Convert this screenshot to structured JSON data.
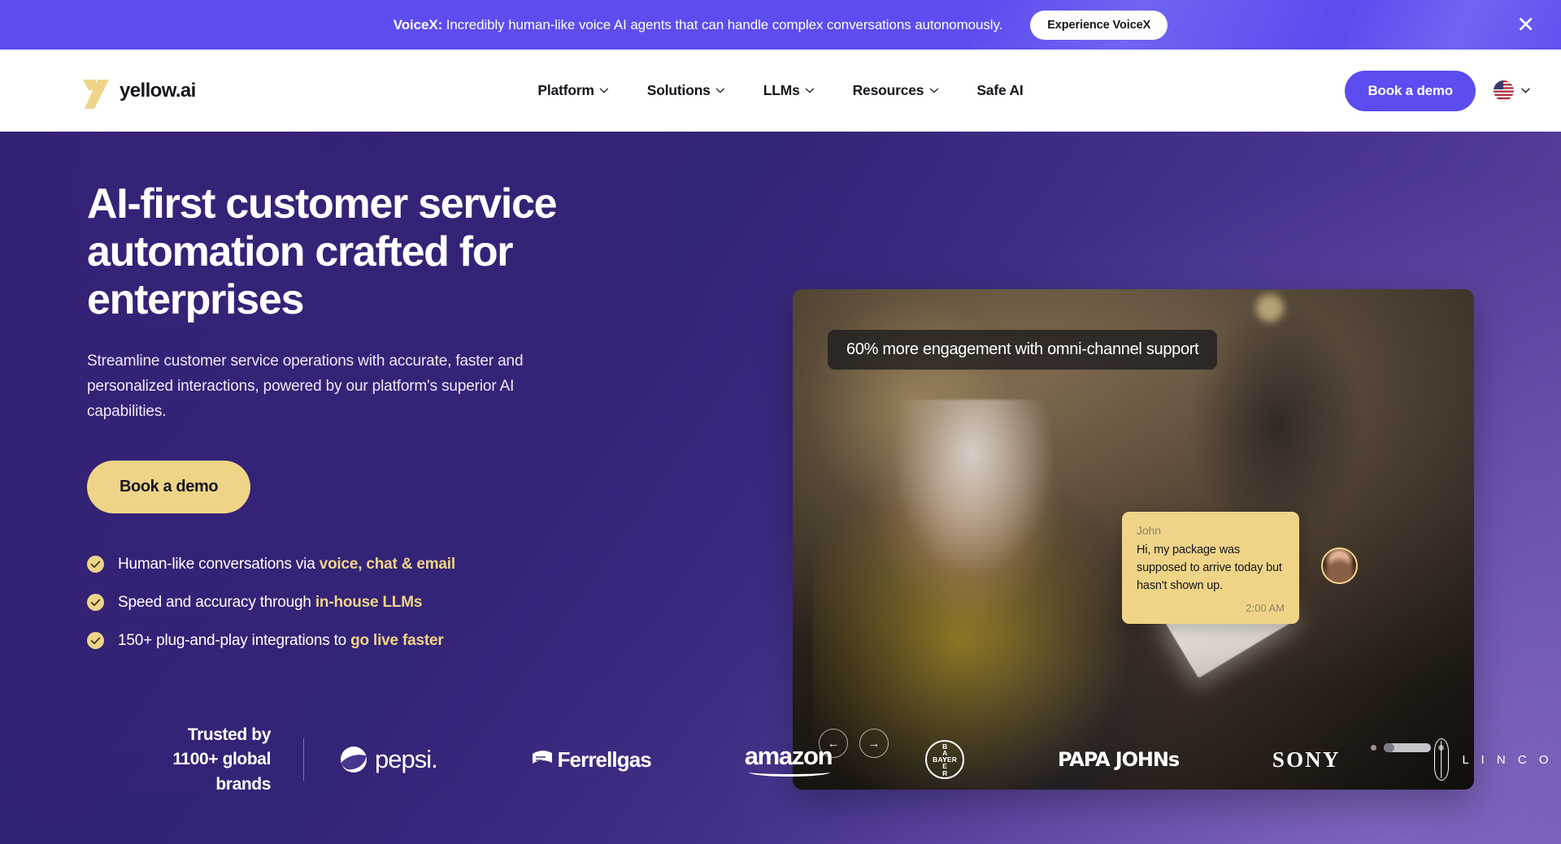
{
  "banner": {
    "brand": "VoiceX:",
    "message": " Incredibly human-like voice AI agents that can handle complex conversations autonomously.",
    "cta": "Experience VoiceX",
    "close_icon": "close-icon"
  },
  "nav": {
    "logo_text": "yellow.ai",
    "items": [
      {
        "label": "Platform",
        "has_dropdown": true
      },
      {
        "label": "Solutions",
        "has_dropdown": true
      },
      {
        "label": "LLMs",
        "has_dropdown": true
      },
      {
        "label": "Resources",
        "has_dropdown": true
      },
      {
        "label": "Safe AI",
        "has_dropdown": false
      }
    ],
    "demo_button": "Book a demo",
    "language_flag": "us-flag-icon"
  },
  "hero": {
    "title": "AI-first customer service automation crafted for enterprises",
    "subtitle": "Streamline customer service operations with accurate, faster and personalized interactions, powered by our platform's superior AI capabilities.",
    "cta": "Book a demo",
    "bullets": [
      {
        "text": "Human-like conversations via ",
        "highlight": "voice, chat & email"
      },
      {
        "text": "Speed and accuracy through ",
        "highlight": "in-house LLMs"
      },
      {
        "text": "150+ plug-and-play integrations to ",
        "highlight": "go live faster"
      }
    ]
  },
  "media": {
    "kpi": "60% more engagement with omni-channel support",
    "chat": {
      "name": "John",
      "message": "Hi, my package was supposed to arrive today but hasn't shown up.",
      "time": "2:00 AM"
    },
    "prev_arrow": "←",
    "next_arrow": "→",
    "slide_count": 3,
    "active_slide": 2
  },
  "trusted": {
    "label_line1": "Trusted by",
    "label_line2": "1100+ global brands",
    "brands": [
      {
        "name": "pepsi",
        "display": "pepsi."
      },
      {
        "name": "Ferrellgas",
        "display": "Ferrellgas"
      },
      {
        "name": "amazon",
        "display": "amazon"
      },
      {
        "name": "Bayer",
        "display": "BAYER"
      },
      {
        "name": "Papa Johns",
        "display": "PAPA JOHNs"
      },
      {
        "name": "Sony",
        "display": "SONY"
      },
      {
        "name": "Lincoln",
        "display": "L I N C O"
      }
    ]
  },
  "colors": {
    "banner_purple": "#5b4df0",
    "brand_yellow": "#efd488",
    "hero_purple_dark": "#2e1f6e",
    "hero_purple_light": "#6a53ad",
    "text_dark": "#17161c"
  }
}
